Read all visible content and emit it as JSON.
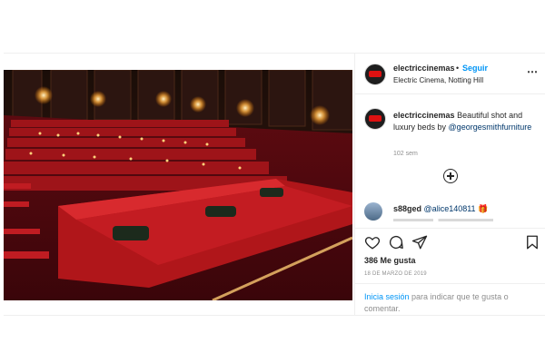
{
  "post": {
    "username": "electriccinemas",
    "dot": "•",
    "follow_label": "Seguir",
    "location": "Electric Cinema, Notting Hill",
    "more_icon": "more-horizontal-icon",
    "caption_user": "electriccinemas",
    "caption_text": "Beautiful shot and luxury beds by",
    "caption_mention": "@georgesmithfurniture",
    "caption_time": "102 sem",
    "load_more_icon": "plus-circle-icon",
    "comment_user": "s88ged",
    "comment_mention": "@alice140811",
    "comment_emoji": "🎁",
    "likes": "386 Me gusta",
    "date": "18 DE MARZO DE 2019",
    "login_link": "Inicia sesión",
    "login_text": "para indicar que te gusta o comentar.",
    "colors": {
      "accent": "#0095f6",
      "mention": "#00376b",
      "seat_red": "#b0161a"
    }
  }
}
